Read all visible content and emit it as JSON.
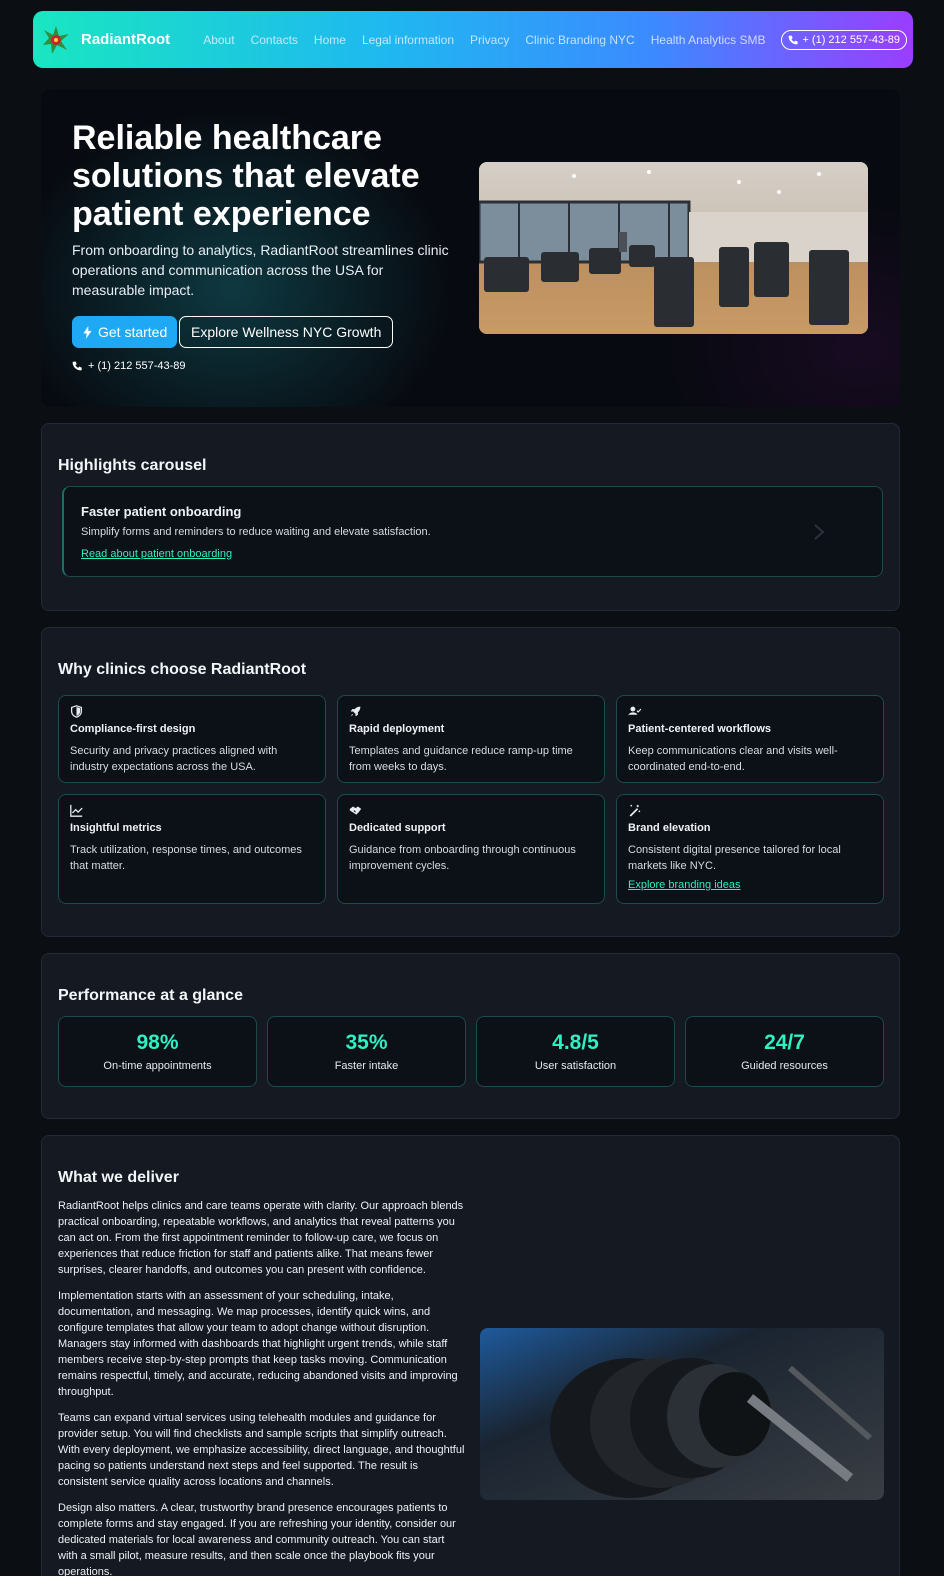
{
  "nav": {
    "brand": "RadiantRoot",
    "links": [
      "About",
      "Contacts",
      "Home",
      "Legal information",
      "Privacy",
      "Clinic Branding NYC",
      "Health Analytics SMB"
    ],
    "phone": "+ (1) 212 557-43-89"
  },
  "hero": {
    "title": "Reliable healthcare solutions that elevate patient experience",
    "subtitle": "From onboarding to analytics, RadiantRoot streamlines clinic operations and communication across the USA for measurable impact.",
    "primary_button": "Get started",
    "secondary_button": "Explore Wellness NYC Growth",
    "phone": "+ (1) 212 557-43-89"
  },
  "carousel": {
    "title": "Highlights carousel",
    "slide": {
      "title": "Faster patient onboarding",
      "description": "Simplify forms and reminders to reduce waiting and elevate satisfaction.",
      "link": "Read about patient onboarding"
    }
  },
  "features": {
    "title": "Why clinics choose RadiantRoot",
    "items": [
      {
        "icon": "shield-icon",
        "title": "Compliance-first design",
        "description": "Security and privacy practices aligned with industry expectations across the USA."
      },
      {
        "icon": "rocket-icon",
        "title": "Rapid deployment",
        "description": "Templates and guidance reduce ramp-up time from weeks to days."
      },
      {
        "icon": "user-check-icon",
        "title": "Patient-centered workflows",
        "description": "Keep communications clear and visits well-coordinated end-to-end."
      },
      {
        "icon": "chart-line-icon",
        "title": "Insightful metrics",
        "description": "Track utilization, response times, and outcomes that matter."
      },
      {
        "icon": "handshake-icon",
        "title": "Dedicated support",
        "description": "Guidance from onboarding through continuous improvement cycles."
      },
      {
        "icon": "magic-wand-icon",
        "title": "Brand elevation",
        "description": "Consistent digital presence tailored for local markets like NYC.",
        "link": "Explore branding ideas"
      }
    ]
  },
  "performance": {
    "title": "Performance at a glance",
    "stats": [
      {
        "value": "98%",
        "label": "On-time appointments"
      },
      {
        "value": "35%",
        "label": "Faster intake"
      },
      {
        "value": "4.8/5",
        "label": "User satisfaction"
      },
      {
        "value": "24/7",
        "label": "Guided resources"
      }
    ]
  },
  "deliver": {
    "title": "What we deliver",
    "paragraphs": [
      "RadiantRoot helps clinics and care teams operate with clarity. Our approach blends practical onboarding, repeatable workflows, and analytics that reveal patterns you can act on. From the first appointment reminder to follow-up care, we focus on experiences that reduce friction for staff and patients alike. That means fewer surprises, clearer handoffs, and outcomes you can present with confidence.",
      "Implementation starts with an assessment of your scheduling, intake, documentation, and messaging. We map processes, identify quick wins, and configure templates that allow your team to adopt change without disruption. Managers stay informed with dashboards that highlight urgent trends, while staff members receive step-by-step prompts that keep tasks moving. Communication remains respectful, timely, and accurate, reducing abandoned visits and improving throughput.",
      "Teams can expand virtual services using telehealth modules and guidance for provider setup. You will find checklists and sample scripts that simplify outreach. With every deployment, we emphasize accessibility, direct language, and thoughtful pacing so patients understand next steps and feel supported. The result is consistent service quality across locations and channels.",
      "Design also matters. A clear, trustworthy brand presence encourages patients to complete forms and stay engaged. If you are refreshing your identity, consider our dedicated materials for local awareness and community outreach. You can start with a small pilot, measure results, and then scale once the playbook fits your operations."
    ]
  }
}
